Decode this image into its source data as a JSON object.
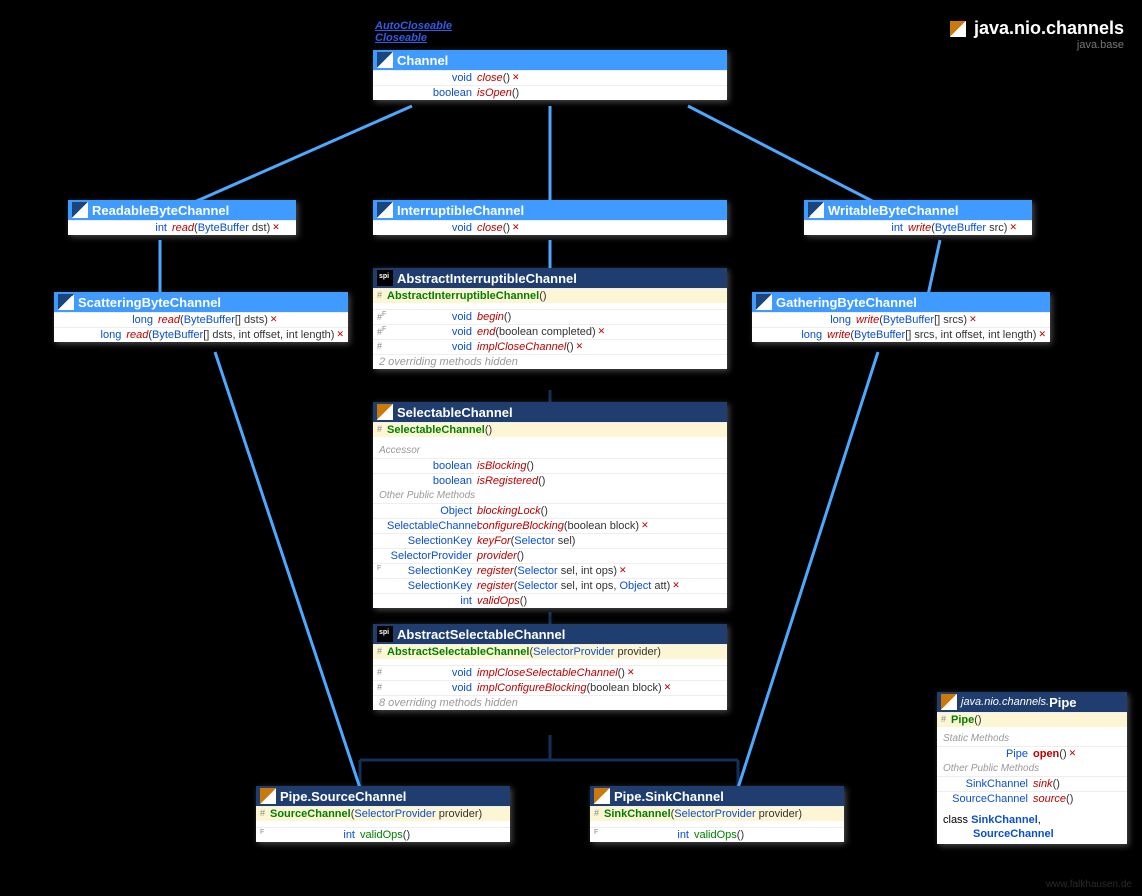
{
  "package": {
    "name": "java.nio.channels",
    "module": "java.base"
  },
  "footer": "www.falkhausen.de",
  "superLinks": [
    "AutoCloseable",
    "Closeable"
  ],
  "boxes": {
    "channel": {
      "title": "Channel",
      "rows": [
        {
          "ret": "void",
          "name": "close",
          "args": "()",
          "em": true,
          "throws": true
        },
        {
          "ret": "boolean",
          "name": "isOpen",
          "args": "()",
          "em": true
        }
      ]
    },
    "readable": {
      "title": "ReadableByteChannel",
      "rows": [
        {
          "ret": "int",
          "name": "read",
          "args_html": "(<span class='param-type'>ByteBuffer</span> dst)",
          "em": true,
          "throws": true
        }
      ]
    },
    "interruptible": {
      "title": "InterruptibleChannel",
      "rows": [
        {
          "ret": "void",
          "name": "close",
          "args": "()",
          "em": true,
          "throws": true
        }
      ]
    },
    "writable": {
      "title": "WritableByteChannel",
      "rows": [
        {
          "ret": "int",
          "name": "write",
          "args_html": "(<span class='param-type'>ByteBuffer</span> src)",
          "em": true,
          "throws": true
        }
      ]
    },
    "scattering": {
      "title": "ScatteringByteChannel",
      "rows": [
        {
          "ret": "long",
          "name": "read",
          "args_html": "(<span class='param-type'>ByteBuffer</span>[] dsts)",
          "em": true,
          "throws": true
        },
        {
          "ret": "long",
          "name": "read",
          "args_html": "(<span class='param-type'>ByteBuffer</span>[] dsts, int offset, int length)",
          "em": true,
          "throws": true
        }
      ]
    },
    "gathering": {
      "title": "GatheringByteChannel",
      "rows": [
        {
          "ret": "long",
          "name": "write",
          "args_html": "(<span class='param-type'>ByteBuffer</span>[] srcs)",
          "em": true,
          "throws": true
        },
        {
          "ret": "long",
          "name": "write",
          "args_html": "(<span class='param-type'>ByteBuffer</span>[] srcs, int offset, int length)",
          "em": true,
          "throws": true
        }
      ]
    },
    "abstractInterruptible": {
      "title": "AbstractInterruptibleChannel",
      "ctor": {
        "vis": "#",
        "name": "AbstractInterruptibleChannel",
        "args": "()"
      },
      "rows": [
        {
          "vis": "#",
          "flag": "F",
          "ret": "void",
          "name": "begin",
          "args": "()",
          "em": true
        },
        {
          "vis": "#",
          "flag": "F",
          "ret": "void",
          "name": "end",
          "args": "(boolean completed)",
          "em": true,
          "throws": true
        },
        {
          "vis": "#",
          "ret": "void",
          "name": "implCloseChannel",
          "args": "()",
          "em": true,
          "throws": true
        }
      ],
      "hidden": "2 overriding methods hidden"
    },
    "selectable": {
      "title": "SelectableChannel",
      "ctor": {
        "vis": "#",
        "name": "SelectableChannel",
        "args": "()"
      },
      "sections": [
        {
          "label": "Accessor",
          "rows": [
            {
              "ret": "boolean",
              "name": "isBlocking",
              "args": "()",
              "em": true
            },
            {
              "ret": "boolean",
              "name": "isRegistered",
              "args": "()",
              "em": true
            }
          ]
        },
        {
          "label": "Other Public Methods",
          "rows": [
            {
              "ret": "Object",
              "name": "blockingLock",
              "args": "()",
              "em": true
            },
            {
              "ret": "SelectableChannel",
              "name": "configureBlocking",
              "args": "(boolean block)",
              "em": true,
              "throws": true
            },
            {
              "ret": "SelectionKey",
              "name": "keyFor",
              "args_html": "(<span class='param-type'>Selector</span> sel)",
              "em": true
            },
            {
              "ret": "SelectorProvider",
              "name": "provider",
              "args": "()",
              "em": true
            },
            {
              "flag": "F",
              "ret": "SelectionKey",
              "name": "register",
              "args_html": "(<span class='param-type'>Selector</span> sel, int ops)",
              "em": true,
              "throws": true
            },
            {
              "ret": "SelectionKey",
              "name": "register",
              "args_html": "(<span class='param-type'>Selector</span> sel, int ops, <span class='param-type'>Object</span> att)",
              "em": true,
              "throws": true
            },
            {
              "ret": "int",
              "name": "validOps",
              "args": "()",
              "em": true
            }
          ]
        }
      ]
    },
    "abstractSelectable": {
      "title": "AbstractSelectableChannel",
      "ctor": {
        "vis": "#",
        "name": "AbstractSelectableChannel",
        "args_html": "(<span class='param-type'>SelectorProvider</span> provider)"
      },
      "rows": [
        {
          "vis": "#",
          "ret": "void",
          "name": "implCloseSelectableChannel",
          "args": "()",
          "em": true,
          "throws": true
        },
        {
          "vis": "#",
          "ret": "void",
          "name": "implConfigureBlocking",
          "args": "(boolean block)",
          "em": true,
          "throws": true
        }
      ],
      "hidden": "8 overriding methods hidden"
    },
    "source": {
      "title": "Pipe.SourceChannel",
      "ctor": {
        "vis": "#",
        "name": "SourceChannel",
        "args_html": "(<span class='param-type'>SelectorProvider</span> provider)"
      },
      "rows": [
        {
          "flag": "F",
          "ret": "int",
          "name": "validOps",
          "args": "()"
        }
      ]
    },
    "sink": {
      "title": "Pipe.SinkChannel",
      "ctor": {
        "vis": "#",
        "name": "SinkChannel",
        "args_html": "(<span class='param-type'>SelectorProvider</span> provider)"
      },
      "rows": [
        {
          "flag": "F",
          "ret": "int",
          "name": "validOps",
          "args": "()"
        }
      ]
    },
    "pipe": {
      "prefix": "java.nio.channels.",
      "title": "Pipe",
      "ctor": {
        "vis": "#",
        "name": "Pipe",
        "args": "()"
      },
      "sections": [
        {
          "label": "Static Methods",
          "rows": [
            {
              "ret": "Pipe",
              "name": "open",
              "args": "()",
              "throws": true,
              "nameClass": "name",
              "nameColor": "#b00"
            }
          ]
        },
        {
          "label": "Other Public Methods",
          "rows": [
            {
              "ret": "SinkChannel",
              "name": "sink",
              "args": "()",
              "em": true
            },
            {
              "ret": "SourceChannel",
              "name": "source",
              "args": "()",
              "em": true
            }
          ]
        }
      ],
      "inner": [
        "SinkChannel",
        "SourceChannel"
      ]
    }
  }
}
